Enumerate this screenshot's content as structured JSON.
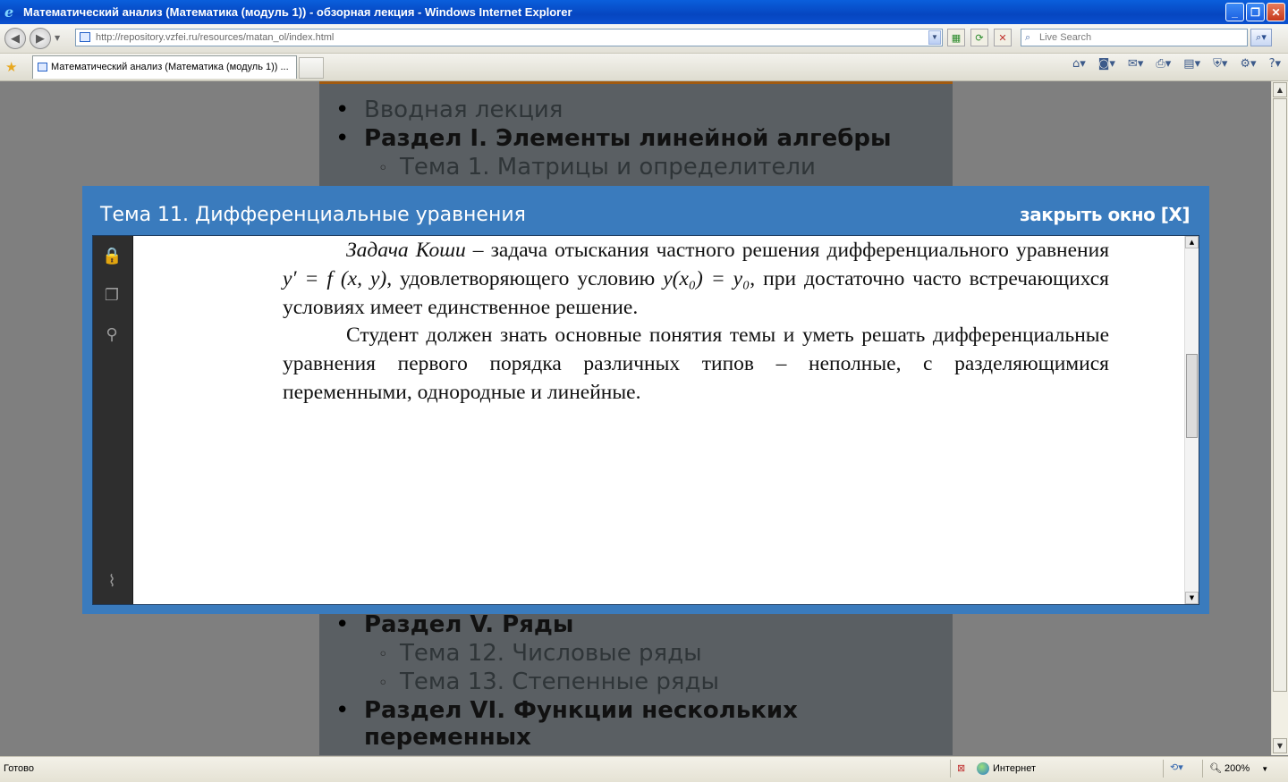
{
  "window": {
    "title": "Математический анализ (Математика (модуль 1)) - обзорная лекция - Windows Internet Explorer",
    "minimize": "_",
    "maximize": "❐",
    "close": "✕"
  },
  "addressbar": {
    "url": "http://repository.vzfei.ru/resources/matan_ol/index.html",
    "search_placeholder": "Live Search"
  },
  "tabs": [
    {
      "label": "Математический анализ (Математика (модуль 1)) ..."
    }
  ],
  "page": {
    "items_top": [
      {
        "text": "Вводная лекция",
        "level": 1,
        "bold": false
      },
      {
        "text": "Раздел I. Элементы линейной алгебры",
        "level": 1,
        "bold": true
      },
      {
        "text": "Тема 1. Матрицы и определители",
        "level": 2
      }
    ],
    "items_bottom": [
      {
        "text": "Раздел V. Ряды",
        "level": 1,
        "bold": true
      },
      {
        "text": "Тема 12. Числовые ряды",
        "level": 2
      },
      {
        "text": "Тема 13. Степенные ряды",
        "level": 2
      },
      {
        "text": "Раздел VI. Функции нескольких",
        "text2": "переменных",
        "level": 1,
        "bold": true
      }
    ]
  },
  "modal": {
    "title": "Тема 11. Дифференциальные уравнения",
    "close_label": "закрыть окно [X]",
    "doc": {
      "p1_italic": "Задача Коши",
      "p1_a": " – задача отыскания частного решения дифференциального уравнения ",
      "formula1": "y′ = f (x, y)",
      "p1_b": ", удовлетворяющего условию ",
      "formula2": "y(x₀) = y₀",
      "p1_c": ", при достаточно часто встречающихся условиях  имеет единственное решение.",
      "p2": "Студент должен знать основные понятия темы и уметь решать дифференциальные уравнения первого порядка различных типов – неполные, с разделяющимися переменными, однородные и линейные."
    }
  },
  "statusbar": {
    "status": "Готово",
    "zone": "Интернет",
    "zoom": "200%"
  }
}
